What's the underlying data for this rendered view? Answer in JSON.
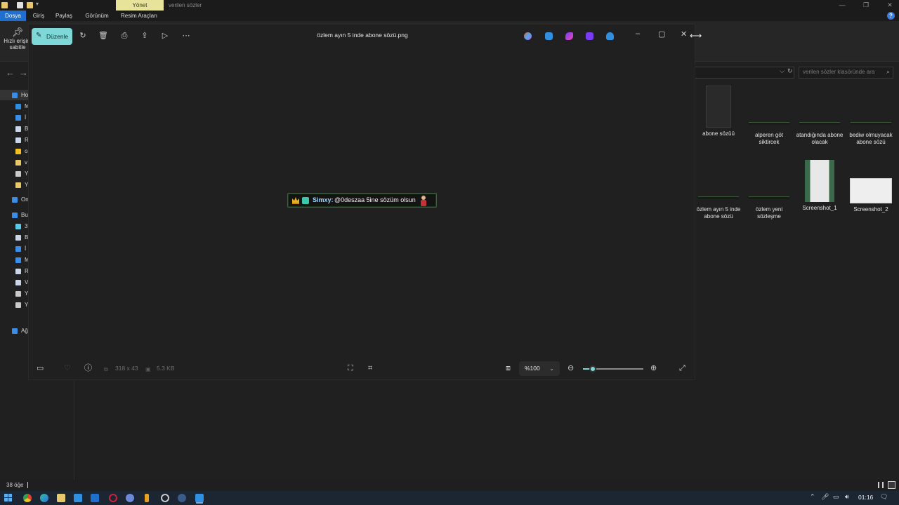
{
  "explorer": {
    "context_tab": "Yönet",
    "window_title": "verilen sözler",
    "ribbon_tabs": [
      "Dosya",
      "Giriş",
      "Paylaş",
      "Görünüm",
      "Resim Araçları"
    ],
    "help": "?",
    "pin_quick_access": [
      "Hızlı erişim",
      "sabitle"
    ],
    "search_placeholder": "verilen sözler klasöründe ara",
    "sidebar": [
      {
        "label": "Ho",
        "icon": "star-icon",
        "color": "#3b8ee8"
      },
      {
        "label": "M",
        "icon": "desktop-icon",
        "color": "#2f8fe0"
      },
      {
        "label": "İ",
        "icon": "download-icon",
        "color": "#3b8ee8"
      },
      {
        "label": "B",
        "icon": "document-icon",
        "color": "#c9d6e8"
      },
      {
        "label": "R",
        "icon": "pictures-icon",
        "color": "#c9d6e8"
      },
      {
        "label": "o",
        "icon": "star-icon",
        "color": "#f0c020"
      },
      {
        "label": "v",
        "icon": "folder-icon",
        "color": "#e8c66a"
      },
      {
        "label": "Y",
        "icon": "drive-icon",
        "color": "#c9c9c9"
      },
      {
        "label": "Y",
        "icon": "folder-icon",
        "color": "#e8c66a"
      },
      {
        "label": "On",
        "icon": "cloud-icon",
        "color": "#3b8ee8"
      },
      {
        "label": "Bu",
        "icon": "computer-icon",
        "color": "#3b8ee8"
      },
      {
        "label": "3",
        "icon": "cube-icon",
        "color": "#5ac8e8"
      },
      {
        "label": "B",
        "icon": "document-icon",
        "color": "#c9d6e8"
      },
      {
        "label": "İ",
        "icon": "download-icon",
        "color": "#3b8ee8"
      },
      {
        "label": "M",
        "icon": "music-icon",
        "color": "#3b8ee8"
      },
      {
        "label": "R",
        "icon": "pictures-icon",
        "color": "#c9d6e8"
      },
      {
        "label": "V",
        "icon": "video-icon",
        "color": "#c9d6e8"
      },
      {
        "label": "Y",
        "icon": "drive-icon",
        "color": "#c9c9c9"
      },
      {
        "label": "Y",
        "icon": "drive-icon",
        "color": "#c9c9c9"
      },
      {
        "label": "Ağ",
        "icon": "network-icon",
        "color": "#3b8ee8"
      }
    ],
    "files": [
      {
        "name": "abone sözüü",
        "thumb": "document"
      },
      {
        "name": "alperen göt siktircek",
        "thumb": "strip"
      },
      {
        "name": "atandığında abone olacak",
        "thumb": "strip"
      },
      {
        "name": "bediw olmuyacak abone sözü",
        "thumb": "strip"
      },
      {
        "name": "özlem ayın 5 inde abone sözü",
        "thumb": "strip"
      },
      {
        "name": "özlem yeni sözleşme",
        "thumb": "strip"
      },
      {
        "name": "Screenshot_1",
        "thumb": "green-doc"
      },
      {
        "name": "Screenshot_2",
        "thumb": "white-doc"
      }
    ],
    "status_count": "38 öğe"
  },
  "viewer": {
    "edit_label": "Düzenle",
    "filename": "özlem ayın 5 inde abone sözü.png",
    "dimensions": "318 x 43",
    "file_size": "5.3 KB",
    "zoom_label": "%100",
    "zoom_fraction": 0.16,
    "image": {
      "username": "Simxy:",
      "message": "@0deszaa 5ine sözüm olsun"
    }
  },
  "taskbar": {
    "clock": "01:16"
  },
  "colors": {
    "accent": "#7ed8d8",
    "explorer_tab_active": "#1f6fd1",
    "context_tab": "#e8e39b"
  }
}
